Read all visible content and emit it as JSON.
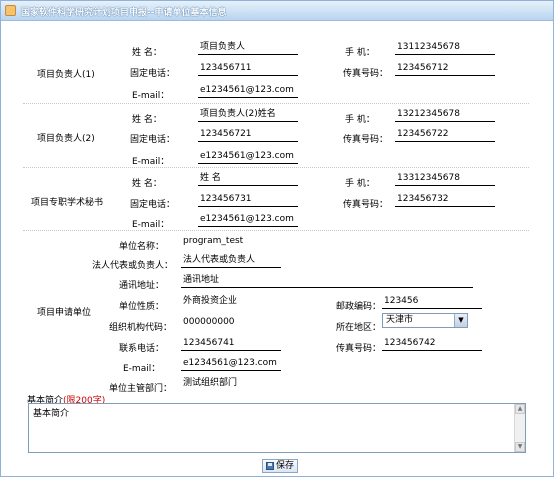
{
  "window": {
    "title": "国家软件科学研究计划项目申报--申请单位基本信息"
  },
  "groups": {
    "leader1": "项目负责人(1)",
    "leader2": "项目负责人(2)",
    "secretary": "项目专职学术秘书",
    "unit": "项目申请单位"
  },
  "labels": {
    "name": "姓 名：",
    "phone": "固定电话：",
    "email": "E-mail：",
    "mobile": "手 机：",
    "fax": "传真号码：",
    "unit_name": "单位名称：",
    "legal_rep": "法人代表或负责人：",
    "address": "通讯地址：",
    "unit_nature": "单位性质：",
    "postcode": "邮政编码：",
    "org_code": "组织机构代码：",
    "region": "所在地区：",
    "contact_phone": "联系电话：",
    "unit_fax": "传真号码：",
    "unit_email": "E-mail：",
    "dept": "单位主管部门："
  },
  "leader1": {
    "name": "项目负责人",
    "phone": "123456711",
    "email": "e1234561@123.com",
    "mobile": "13112345678",
    "fax": "123456712"
  },
  "leader2": {
    "name": "项目负责人(2)姓名",
    "phone": "123456721",
    "email": "e1234561@123.com",
    "mobile": "13212345678",
    "fax": "123456722"
  },
  "secretary": {
    "name": "姓 名",
    "phone": "123456731",
    "email": "e1234561@123.com",
    "mobile": "13312345678",
    "fax": "123456732"
  },
  "unit": {
    "name": "program_test",
    "legal_rep": "法人代表或负责人",
    "address": "通讯地址",
    "nature": "外商投资企业",
    "postcode": "123456",
    "org_code": "000000000",
    "region": "天津市",
    "contact_phone": "123456741",
    "fax": "123456742",
    "email": "e1234561@123.com",
    "dept": "测试组织部门"
  },
  "intro": {
    "label": "基本简介",
    "limit": "(限200字)",
    "value": "基本简介"
  },
  "save_label": "保存",
  "icons": {
    "title": "form-icon",
    "save": "floppy-icon",
    "dropdown": "chevron-down-icon"
  }
}
